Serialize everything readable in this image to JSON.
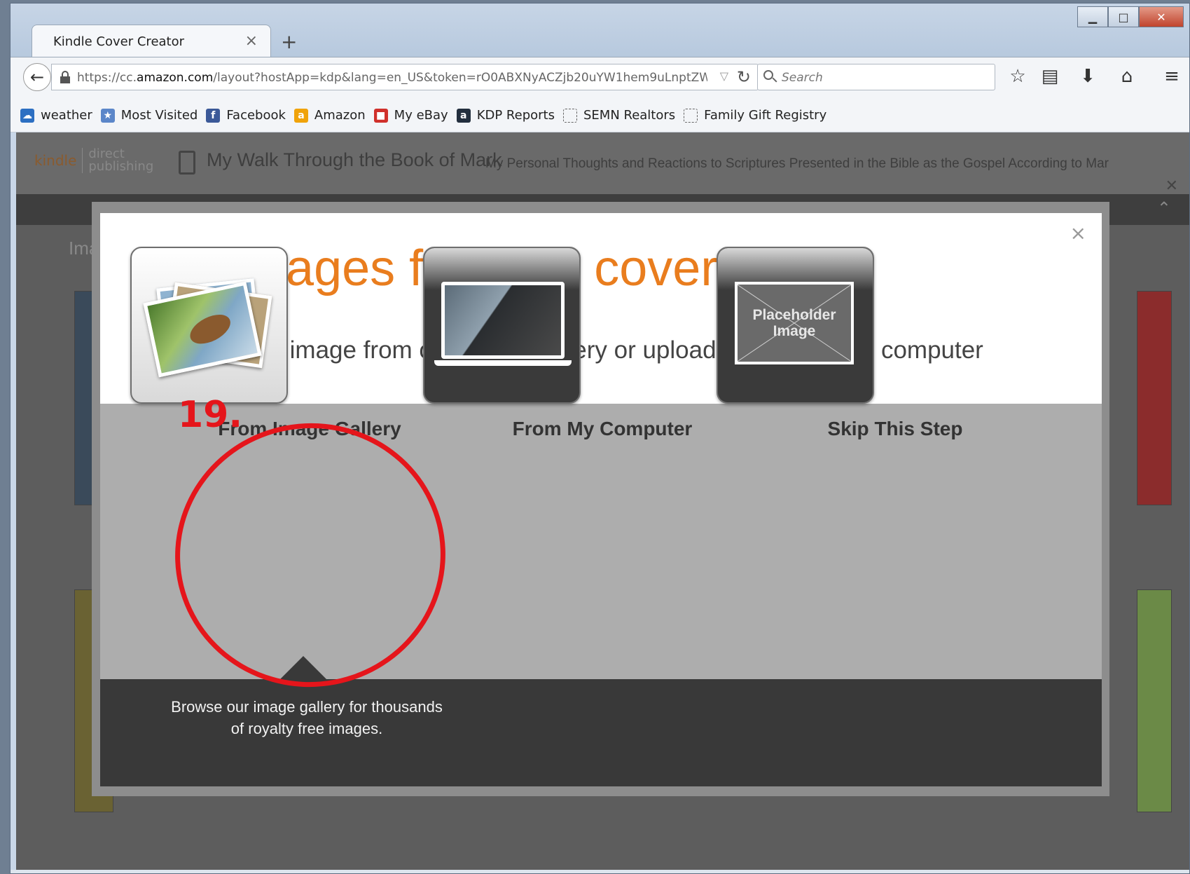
{
  "browser": {
    "tab_title": "Kindle Cover Creator",
    "tab_close": "×",
    "new_tab": "+",
    "url_prefix": "https://cc.",
    "url_host": "amazon.com",
    "url_path": "/layout?hostApp=kdp&lang=en_US&token=rO0ABXNyACZjb20uYW1hem9uLnptZW",
    "search_placeholder": "Search",
    "toolbar_icons": [
      "star-icon",
      "reading-list-icon",
      "download-icon",
      "home-icon",
      "menu-icon"
    ],
    "bookmarks": [
      {
        "label": "weather",
        "icon": "weather-icon",
        "color": "#2c6fc2"
      },
      {
        "label": "Most Visited",
        "icon": "most-visited-icon",
        "color": "#5b86c9"
      },
      {
        "label": "Facebook",
        "icon": "facebook-icon",
        "color": "#3b5998"
      },
      {
        "label": "Amazon",
        "icon": "amazon-icon",
        "color": "#f0a30a"
      },
      {
        "label": "My eBay",
        "icon": "ebay-icon",
        "color": "#d0302b"
      },
      {
        "label": "KDP Reports",
        "icon": "amazon-icon",
        "color": "#232f3e"
      },
      {
        "label": "SEMN Realtors",
        "icon": "blank-page-icon",
        "color": ""
      },
      {
        "label": "Family Gift Registry",
        "icon": "blank-page-icon",
        "color": ""
      }
    ]
  },
  "page": {
    "logo_kindle": "kindle",
    "logo_dp_1": "direct",
    "logo_dp_2": "publishing",
    "book_title": "My Walk Through the Book of Mark",
    "book_subtitle": "My Personal Thoughts and Reactions to Scriptures Presented in the Bible as the Gospel According to Mar",
    "heading": "Ima"
  },
  "modal": {
    "title": "Get images for your cover",
    "subtitle": "Select an image from our image gallery or upload one from your computer",
    "close": "×",
    "options": [
      {
        "label": "From Image Gallery",
        "icon": "image-gallery-icon"
      },
      {
        "label": "From My Computer",
        "icon": "laptop-icon"
      },
      {
        "label": "Skip This Step",
        "icon": "placeholder-image-icon",
        "icon_text_1": "Placeholder",
        "icon_text_2": "Image"
      }
    ],
    "description": "Browse our image gallery for thousands of royalty free images."
  },
  "annotation": {
    "number": "19.",
    "color": "#e5151b"
  },
  "colors": {
    "accent_orange": "#e97d1e",
    "info_panel": "#393939",
    "options_band": "#adadad"
  }
}
